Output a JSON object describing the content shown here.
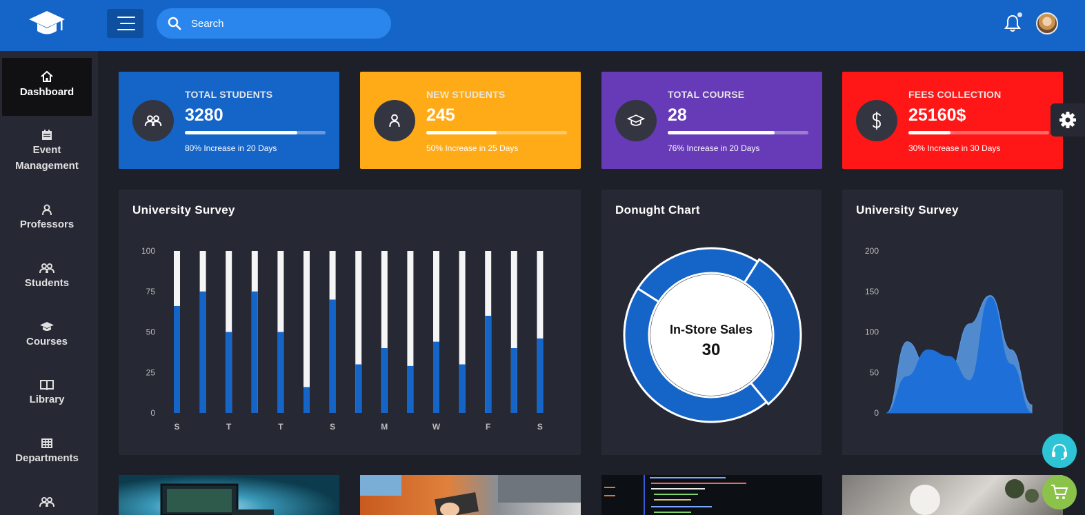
{
  "header": {
    "search_placeholder": "Search",
    "logo_icon": "graduation-cap-icon",
    "notification_icon": "bell-icon"
  },
  "sidebar": {
    "items": [
      {
        "label": "Dashboard",
        "icon": "home-icon",
        "active": true
      },
      {
        "label": "Event Management",
        "icon": "calendar-icon"
      },
      {
        "label": "Professors",
        "icon": "user-icon"
      },
      {
        "label": "Students",
        "icon": "users-icon"
      },
      {
        "label": "Courses",
        "icon": "graduation-cap-icon"
      },
      {
        "label": "Library",
        "icon": "book-icon"
      },
      {
        "label": "Departments",
        "icon": "building-icon"
      }
    ]
  },
  "stats": [
    {
      "label": "TOTAL STUDENTS",
      "value": "3280",
      "progress": 0.8,
      "note": "80% Increase in 20 Days",
      "color": "#1565c9",
      "icon": "users-icon"
    },
    {
      "label": "NEW STUDENTS",
      "value": "245",
      "progress": 0.5,
      "note": "50% Increase in 25 Days",
      "color": "#ffab17",
      "icon": "user-icon"
    },
    {
      "label": "TOTAL COURSE",
      "value": "28",
      "progress": 0.76,
      "note": "76% Increase in 20 Days",
      "color": "#673ab7",
      "icon": "graduation-cap-icon"
    },
    {
      "label": "FEES COLLECTION",
      "value": "25160$",
      "progress": 0.3,
      "note": "30% Increase in 30 Days",
      "color": "#ff1717",
      "icon": "dollar-icon"
    }
  ],
  "panels": {
    "survey1_title": "University Survey",
    "donut_title": "Donught Chart",
    "survey2_title": "University Survey"
  },
  "chart_data": [
    {
      "type": "bar",
      "title": "University Survey",
      "ylim": [
        0,
        100
      ],
      "yticks": [
        "100",
        "75",
        "50",
        "25",
        "0"
      ],
      "xticks": [
        "S",
        "T",
        "T",
        "S",
        "M",
        "W",
        "F",
        "S"
      ],
      "values": [
        66,
        75,
        50,
        75,
        50,
        16,
        70,
        30,
        40,
        29,
        44,
        30,
        60,
        40,
        46
      ],
      "bar_color": "#1565c9",
      "track_color": "#f5f5f5"
    },
    {
      "type": "pie",
      "title": "Donught Chart",
      "center_label": "In-Store Sales",
      "center_value": "30",
      "values": [
        25,
        30,
        45
      ],
      "color": "#1565c9"
    },
    {
      "type": "area",
      "title": "University Survey",
      "ylim": [
        0,
        200
      ],
      "yticks": [
        "200",
        "150",
        "100",
        "50",
        "0"
      ],
      "series": [
        {
          "values": [
            0,
            45,
            78,
            70,
            40,
            143,
            60,
            0
          ]
        },
        {
          "values": [
            0,
            88,
            55,
            48,
            110,
            145,
            78,
            10
          ]
        }
      ],
      "colors": [
        "#1f6fd8",
        "#5b9bea"
      ]
    }
  ]
}
